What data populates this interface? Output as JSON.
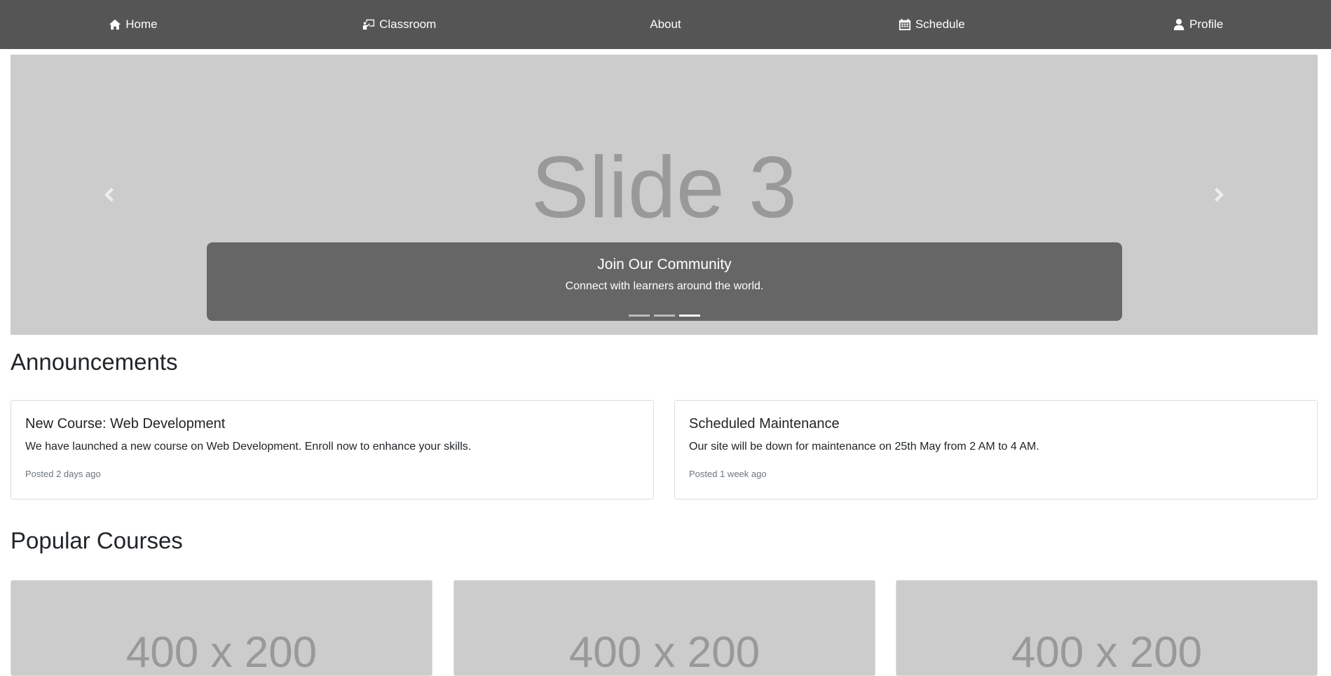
{
  "nav": {
    "items": [
      {
        "label": "Home",
        "icon": "home-icon"
      },
      {
        "label": "Classroom",
        "icon": "classroom-icon"
      },
      {
        "label": "About",
        "icon": ""
      },
      {
        "label": "Schedule",
        "icon": "calendar-icon"
      },
      {
        "label": "Profile",
        "icon": "user-icon"
      }
    ]
  },
  "carousel": {
    "slide_text": "Slide 3",
    "caption_title": "Join Our Community",
    "caption_text": "Connect with learners around the world.",
    "indicator_count": 3,
    "active_indicator": 3,
    "prev_icon": "chevron-left-icon",
    "next_icon": "chevron-right-icon"
  },
  "announcements": {
    "title": "Announcements",
    "items": [
      {
        "title": "New Course: Web Development",
        "text": "We have launched a new course on Web Development. Enroll now to enhance your skills.",
        "meta": "Posted 2 days ago"
      },
      {
        "title": "Scheduled Maintenance",
        "text": "Our site will be down for maintenance on 25th May from 2 AM to 4 AM.",
        "meta": "Posted 1 week ago"
      }
    ]
  },
  "courses": {
    "title": "Popular Courses",
    "items": [
      {
        "image_text": "400 x 200"
      },
      {
        "image_text": "400 x 200"
      },
      {
        "image_text": "400 x 200"
      }
    ]
  },
  "colors": {
    "navbar": "#555555",
    "carousel_bg": "#cccccc",
    "caption_bg": "#666666"
  }
}
